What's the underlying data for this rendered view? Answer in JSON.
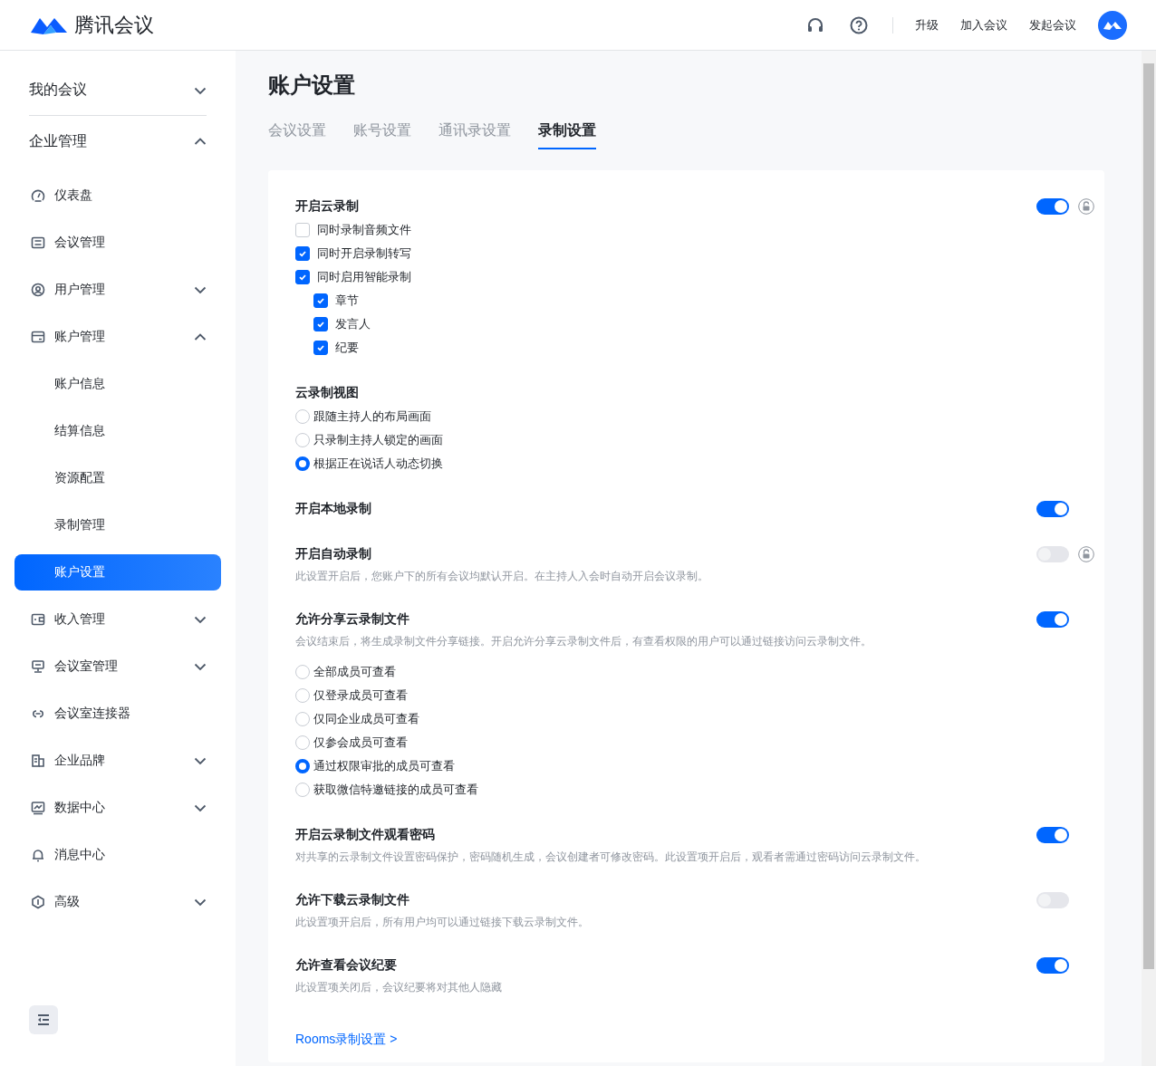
{
  "header": {
    "brand": "腾讯会议",
    "links": [
      "升级",
      "加入会议",
      "发起会议"
    ]
  },
  "sidebar": {
    "groups": [
      {
        "label": "我的会议",
        "expanded": false
      },
      {
        "label": "企业管理",
        "expanded": true,
        "items": [
          {
            "label": "仪表盘",
            "selected": false
          },
          {
            "label": "会议管理",
            "selected": false
          },
          {
            "label": "用户管理",
            "selected": false,
            "expanded": false
          },
          {
            "label": "账户管理",
            "selected": false,
            "expanded": true,
            "children": [
              {
                "label": "账户信息",
                "selected": false
              },
              {
                "label": "结算信息",
                "selected": false
              },
              {
                "label": "资源配置",
                "selected": false
              },
              {
                "label": "录制管理",
                "selected": false
              },
              {
                "label": "账户设置",
                "selected": true
              }
            ]
          },
          {
            "label": "收入管理",
            "selected": false,
            "expanded": false
          },
          {
            "label": "会议室管理",
            "selected": false,
            "expanded": false
          },
          {
            "label": "会议室连接器",
            "selected": false
          },
          {
            "label": "企业品牌",
            "selected": false,
            "expanded": false
          },
          {
            "label": "数据中心",
            "selected": false,
            "expanded": false
          },
          {
            "label": "消息中心",
            "selected": false
          },
          {
            "label": "高级",
            "selected": false,
            "expanded": false
          }
        ]
      }
    ]
  },
  "page": {
    "title": "账户设置",
    "tabs": [
      {
        "label": "会议设置",
        "selected": false
      },
      {
        "label": "账号设置",
        "selected": false
      },
      {
        "label": "通讯录设置",
        "selected": false
      },
      {
        "label": "录制设置",
        "selected": true
      }
    ]
  },
  "sections": [
    {
      "title": "开启云录制",
      "on": true,
      "locked": false,
      "options": [
        {
          "kind": "checkbox",
          "label": "同时录制音频文件",
          "checked": false
        },
        {
          "kind": "checkbox",
          "label": "同时开启录制转写",
          "checked": true
        },
        {
          "kind": "checkbox",
          "label": "同时启用智能录制",
          "checked": true,
          "children": [
            {
              "kind": "checkbox",
              "label": "章节",
              "checked": true
            },
            {
              "kind": "checkbox",
              "label": "发言人",
              "checked": true
            },
            {
              "kind": "checkbox",
              "label": "纪要",
              "checked": true
            }
          ]
        }
      ]
    },
    {
      "title": "云录制视图",
      "options": [
        {
          "kind": "radio",
          "label": "跟随主持人的布局画面",
          "selected": false
        },
        {
          "kind": "radio",
          "label": "只录制主持人锁定的画面",
          "selected": false
        },
        {
          "kind": "radio",
          "label": "根据正在说话人动态切换",
          "selected": true
        }
      ]
    },
    {
      "title": "开启本地录制",
      "on": true
    },
    {
      "title": "开启自动录制",
      "on": false,
      "locked": false,
      "description": "此设置开启后，您账户下的所有会议均默认开启。在主持人入会时自动开启会议录制。"
    },
    {
      "title": "允许分享云录制文件",
      "on": true,
      "description": "会议结束后，将生成录制文件分享链接。开启允许分享云录制文件后，有查看权限的用户可以通过链接访问云录制文件。",
      "options": [
        {
          "kind": "radio",
          "label": "全部成员可查看",
          "selected": false
        },
        {
          "kind": "radio",
          "label": "仅登录成员可查看",
          "selected": false
        },
        {
          "kind": "radio",
          "label": "仅同企业成员可查看",
          "selected": false
        },
        {
          "kind": "radio",
          "label": "仅参会成员可查看",
          "selected": false
        },
        {
          "kind": "radio",
          "label": "通过权限审批的成员可查看",
          "selected": true
        },
        {
          "kind": "radio",
          "label": "获取微信特邀链接的成员可查看",
          "selected": false
        }
      ]
    },
    {
      "title": "开启云录制文件观看密码",
      "on": true,
      "description": "对共享的云录制文件设置密码保护，密码随机生成，会议创建者可修改密码。此设置项开启后，观看者需通过密码访问云录制文件。"
    },
    {
      "title": "允许下载云录制文件",
      "on": false,
      "description": "此设置项开启后，所有用户均可以通过链接下载云录制文件。"
    },
    {
      "title": "允许查看会议纪要",
      "on": true,
      "description": "此设置项关闭后，会议纪要将对其他人隐藏"
    }
  ],
  "link": "Rooms录制设置 >"
}
